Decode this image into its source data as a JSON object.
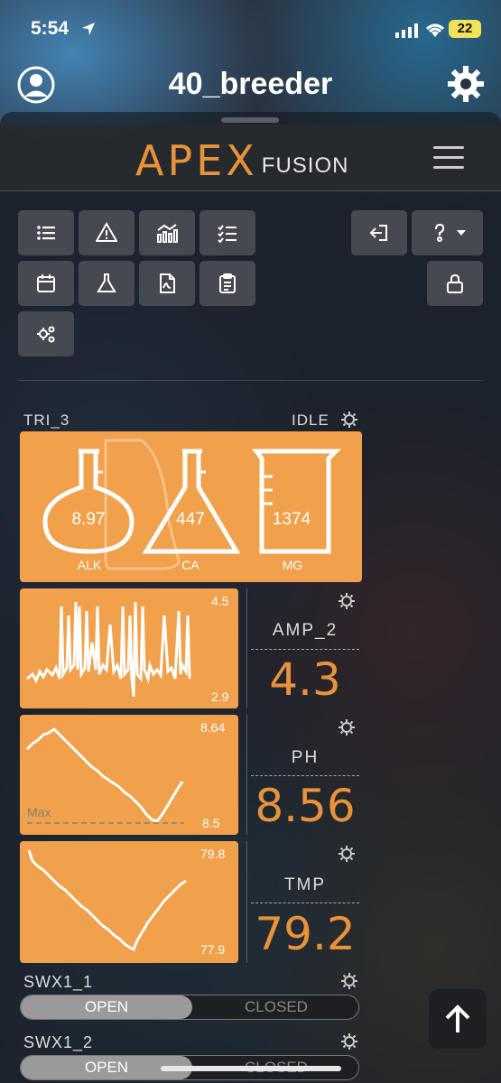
{
  "status": {
    "time": "5:54",
    "battery": "22"
  },
  "header": {
    "title": "40_breeder"
  },
  "apex": {
    "brand": "APEX",
    "sub": "FUSION"
  },
  "toolbar": {
    "icons": [
      "list-icon",
      "warning-icon",
      "chart-icon",
      "checklist-icon",
      "calendar-icon",
      "flask-icon",
      "pdf-icon",
      "clipboard-icon",
      "cogs-icon",
      "logout-icon",
      "help-icon",
      "lock-icon"
    ]
  },
  "trident": {
    "name": "TRI_3",
    "state": "IDLE",
    "alk": {
      "value": "8.97",
      "label": "ALK"
    },
    "ca": {
      "value": "447",
      "label": "CA"
    },
    "mg": {
      "value": "1374",
      "label": "MG"
    }
  },
  "probes": [
    {
      "name": "AMP_2",
      "value": "4.3",
      "hi": "4.5",
      "lo": "2.9"
    },
    {
      "name": "PH",
      "value": "8.56",
      "hi": "8.64",
      "lo": "8.5",
      "max_label": "Max"
    },
    {
      "name": "TMP",
      "value": "79.2",
      "hi": "79.8",
      "lo": "77.9"
    }
  ],
  "switches": [
    {
      "name": "SWX1_1",
      "on": "OPEN",
      "off": "CLOSED"
    },
    {
      "name": "SWX1_2",
      "on": "OPEN",
      "off": "CLOSED"
    }
  ],
  "colors": {
    "accent": "#e8923a",
    "panel": "#f1a04c"
  }
}
